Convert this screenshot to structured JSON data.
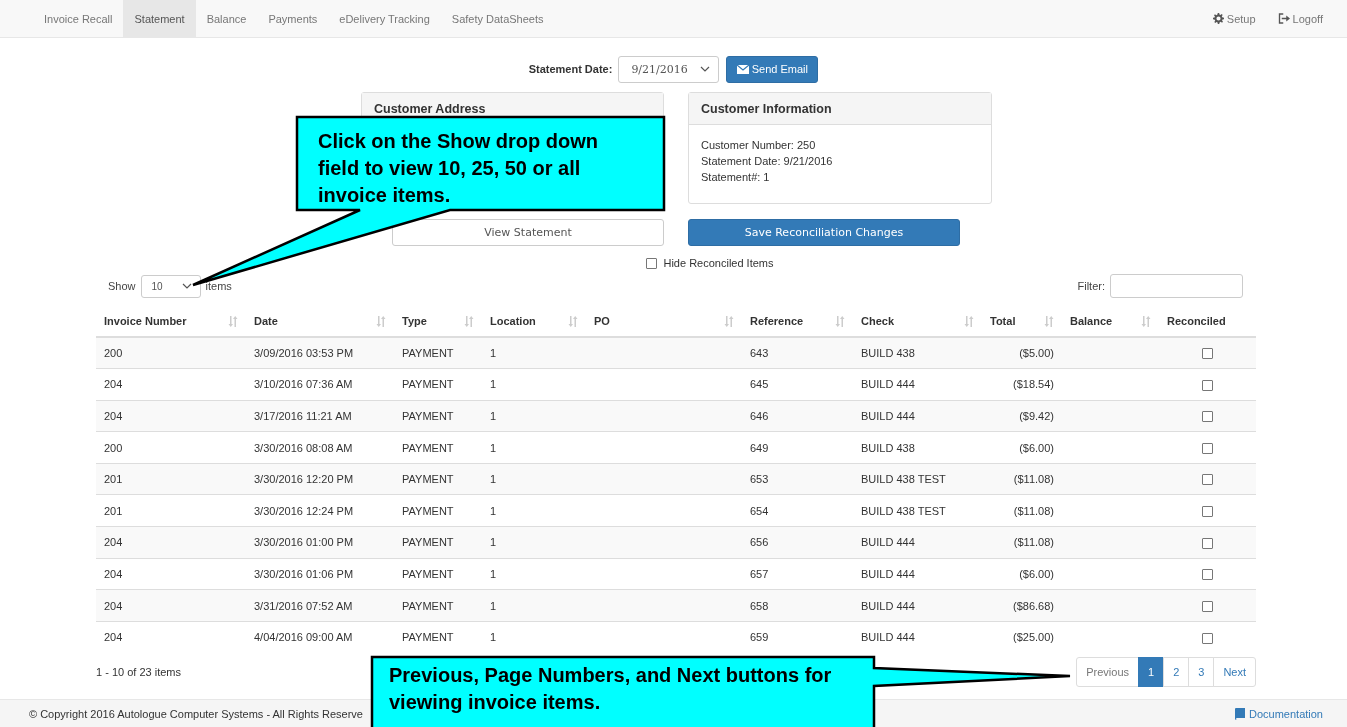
{
  "nav": {
    "tabs": [
      {
        "label": "Invoice Recall",
        "selected": false
      },
      {
        "label": "Statement",
        "selected": true
      },
      {
        "label": "Balance",
        "selected": false
      },
      {
        "label": "Payments",
        "selected": false
      },
      {
        "label": "eDelivery Tracking",
        "selected": false
      },
      {
        "label": "Safety DataSheets",
        "selected": false
      }
    ],
    "links": [
      {
        "label": "Setup",
        "kind": "setup"
      },
      {
        "label": "Logoff",
        "kind": "logoff"
      }
    ]
  },
  "statement_date": {
    "label": "Statement Date:",
    "value": "9/21/2016"
  },
  "send_email": "Send Email",
  "customer_address": {
    "title": "Customer Address"
  },
  "customer_information": {
    "title": "Customer Information",
    "lines": [
      "Customer Number: 250",
      "Statement Date: 9/21/2016",
      "Statement#: 1"
    ]
  },
  "view_statement": "View Statement",
  "save_button": "Save Reconciliation Changes",
  "hide_reconciled": {
    "label": "Hide Reconciled Items",
    "checked": false
  },
  "show": {
    "label": "Show",
    "value": "10",
    "suffix": "items"
  },
  "filter": {
    "label": "Filter:"
  },
  "table": {
    "columns": [
      {
        "label": "Invoice Number",
        "sortable": true
      },
      {
        "label": "Date",
        "sortable": true
      },
      {
        "label": "Type",
        "sortable": true
      },
      {
        "label": "Location",
        "sortable": true
      },
      {
        "label": "PO",
        "sortable": true
      },
      {
        "label": "Reference",
        "sortable": true
      },
      {
        "label": "Check",
        "sortable": true
      },
      {
        "label": "Total",
        "sortable": true
      },
      {
        "label": "Balance",
        "sortable": true
      },
      {
        "label": "Reconciled",
        "sortable": false
      }
    ],
    "rows": [
      {
        "invoice": "200",
        "date": "3/09/2016 03:53 PM",
        "type": "PAYMENT",
        "location": "1",
        "reference": "643",
        "check": "BUILD 438",
        "total": "($5.00)",
        "reconciled": false
      },
      {
        "invoice": "204",
        "date": "3/10/2016 07:36 AM",
        "type": "PAYMENT",
        "location": "1",
        "reference": "645",
        "check": "BUILD 444",
        "total": "($18.54)",
        "reconciled": false
      },
      {
        "invoice": "204",
        "date": "3/17/2016 11:21 AM",
        "type": "PAYMENT",
        "location": "1",
        "reference": "646",
        "check": "BUILD 444",
        "total": "($9.42)",
        "reconciled": false
      },
      {
        "invoice": "200",
        "date": "3/30/2016 08:08 AM",
        "type": "PAYMENT",
        "location": "1",
        "reference": "649",
        "check": "BUILD 438",
        "total": "($6.00)",
        "reconciled": false
      },
      {
        "invoice": "201",
        "date": "3/30/2016 12:20 PM",
        "type": "PAYMENT",
        "location": "1",
        "reference": "653",
        "check": "BUILD 438 TEST",
        "total": "($11.08)",
        "reconciled": false
      },
      {
        "invoice": "201",
        "date": "3/30/2016 12:24 PM",
        "type": "PAYMENT",
        "location": "1",
        "reference": "654",
        "check": "BUILD 438 TEST",
        "total": "($11.08)",
        "reconciled": false
      },
      {
        "invoice": "204",
        "date": "3/30/2016 01:00 PM",
        "type": "PAYMENT",
        "location": "1",
        "reference": "656",
        "check": "BUILD 444",
        "total": "($11.08)",
        "reconciled": false
      },
      {
        "invoice": "204",
        "date": "3/30/2016 01:06 PM",
        "type": "PAYMENT",
        "location": "1",
        "reference": "657",
        "check": "BUILD 444",
        "total": "($6.00)",
        "reconciled": false
      },
      {
        "invoice": "204",
        "date": "3/31/2016 07:52 AM",
        "type": "PAYMENT",
        "location": "1",
        "reference": "658",
        "check": "BUILD 444",
        "total": "($86.68)",
        "reconciled": false
      },
      {
        "invoice": "204",
        "date": "4/04/2016 09:00 AM",
        "type": "PAYMENT",
        "location": "1",
        "reference": "659",
        "check": "BUILD 444",
        "total": "($25.00)",
        "reconciled": false
      }
    ]
  },
  "summary": "1 - 10 of 23 items",
  "pagination": {
    "previous": "Previous",
    "pages": [
      {
        "label": "1",
        "selected": true
      },
      {
        "label": "2",
        "selected": false
      },
      {
        "label": "3",
        "selected": false
      }
    ],
    "next": "Next"
  },
  "footer": {
    "copyright": "© Copyright 2016 Autologue Computer Systems - All Rights Reserve",
    "documentation": "Documentation"
  },
  "callouts": [
    {
      "kind": "show",
      "text": "Click on the Show drop down field to view 10, 25, 50 or all invoice items."
    },
    {
      "kind": "pagination",
      "text": "Previous, Page Numbers, and Next buttons for viewing invoice items."
    }
  ]
}
